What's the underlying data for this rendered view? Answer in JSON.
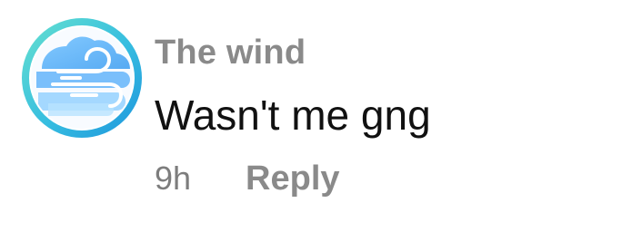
{
  "comment": {
    "author": "The wind",
    "text": "Wasn't me gng",
    "time": "9h",
    "reply_label": "Reply",
    "avatar_icon": "wind-cloud-icon"
  },
  "colors": {
    "author": "#8a8a8a",
    "text": "#111111",
    "meta": "#7d7d7d",
    "avatar_ring_start": "#55d6c4",
    "avatar_ring_end": "#2f9fe0"
  }
}
